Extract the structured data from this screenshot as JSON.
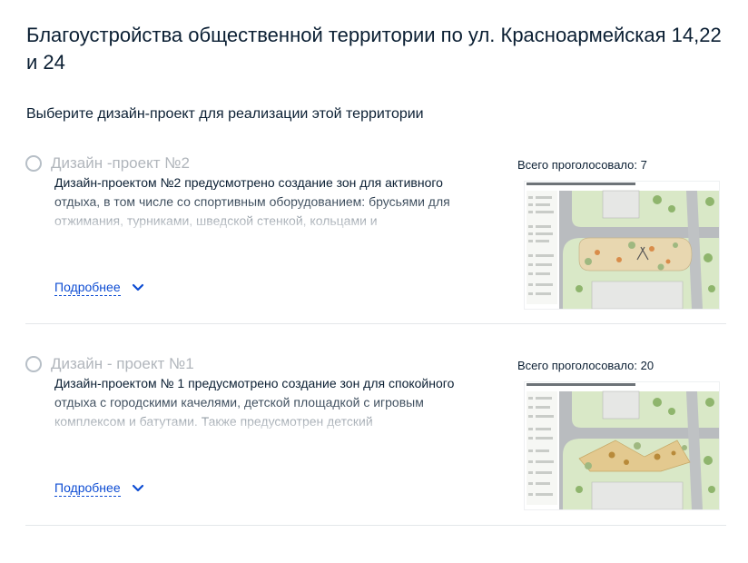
{
  "page": {
    "title": "Благоустройства общественной территории по ул. Красноармейская 14,22 и 24",
    "subtitle": "Выберите дизайн-проект для реализации этой территории"
  },
  "options": [
    {
      "title": "Дизайн -проект №2",
      "description": "Дизайн-проектом №2 предусмотрено создание зон для активного отдыха, в том числе со спортивным оборудованием: брусьями для отжимания, турниками, шведской стенкой, кольцами и",
      "more_label": "Подробнее",
      "votes_text": "Всего проголосовало: 7",
      "image_icon": "site-plan-thumbnail",
      "selected": false
    },
    {
      "title": "Дизайн - проект №1",
      "description": "Дизайн-проектом № 1 предусмотрено создание зон для спокойного отдыха с городскими качелями, детской площадкой с игровым комплексом и батутами. Также предусмотрен детский",
      "more_label": "Подробнее",
      "votes_text": "Всего проголосовало: 20",
      "image_icon": "site-plan-thumbnail",
      "selected": false
    }
  ],
  "colors": {
    "text": "#0b1f33",
    "muted_title": "#b1b6bc",
    "link": "#0d4cd3",
    "divider": "#e4e7ea",
    "plan_green": "#cfe3b8",
    "plan_road": "#b9bcbf"
  }
}
